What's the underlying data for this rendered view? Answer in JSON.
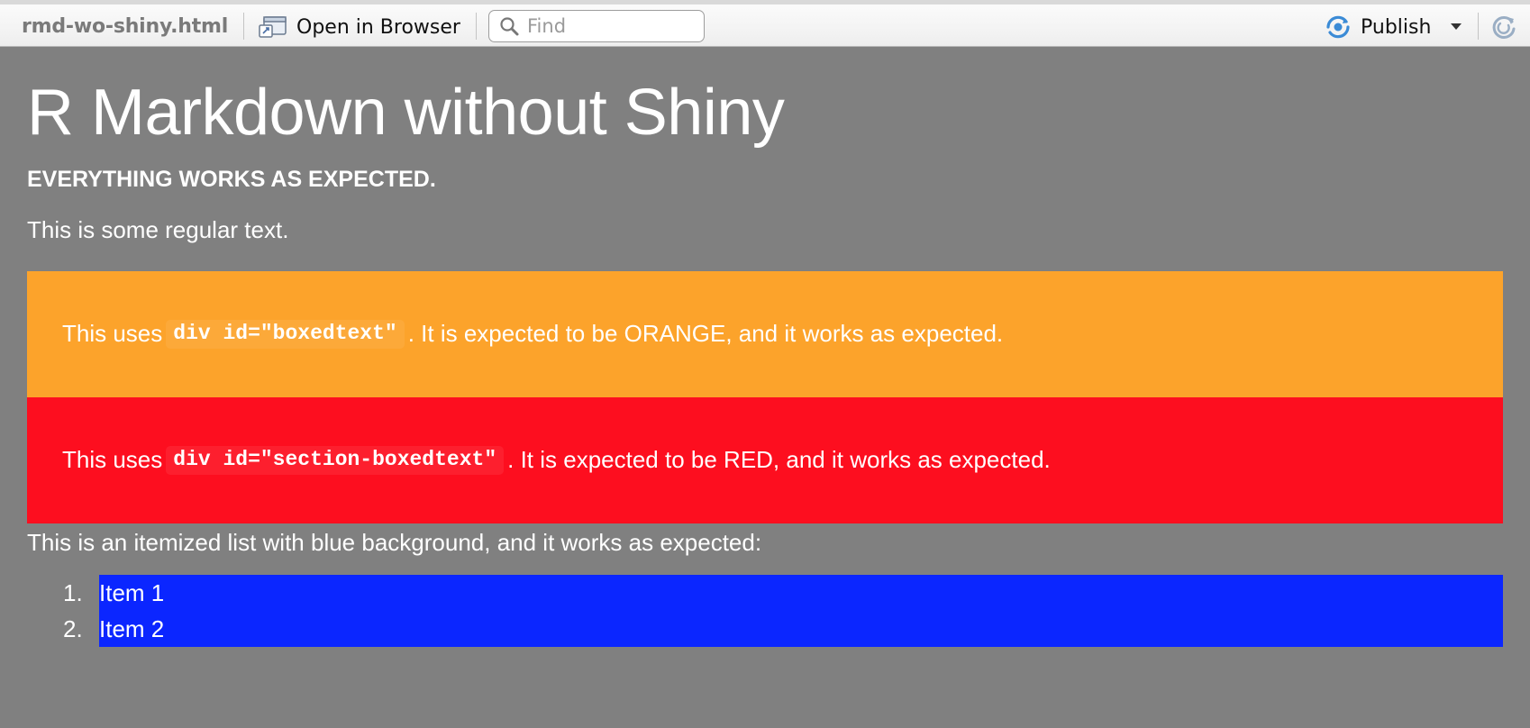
{
  "toolbar": {
    "filename": "rmd-wo-shiny.html",
    "open_in_browser_label": "Open in Browser",
    "find_placeholder": "Find",
    "find_value": "",
    "publish_label": "Publish",
    "icons": {
      "browser": "open-in-browser-icon",
      "search": "search-icon",
      "publish": "publish-icon",
      "publish_menu": "chevron-down-icon",
      "refresh": "refresh-icon"
    },
    "colors": {
      "publish_accent": "#3b8bd6"
    }
  },
  "document": {
    "title": "R Markdown without Shiny",
    "subtitle": "EVERYTHING WORKS AS EXPECTED.",
    "regular_text": "This is some regular text.",
    "orange_box": {
      "prefix": "This uses",
      "code": "div id=\"boxedtext\"",
      "suffix": ". It is expected to be ORANGE, and it works as expected.",
      "color": "#fca32b"
    },
    "red_box": {
      "prefix": "This uses",
      "code": "div id=\"section-boxedtext\"",
      "suffix": ". It is expected to be RED, and it works as expected.",
      "color": "#fd0e1f"
    },
    "list_intro": "This is an itemized list with blue background, and it works as expected:",
    "list_color": "#0b26ff",
    "list_items": [
      {
        "number": "1.",
        "label": "Item 1"
      },
      {
        "number": "2.",
        "label": "Item 2"
      }
    ],
    "background_color": "#808080"
  }
}
